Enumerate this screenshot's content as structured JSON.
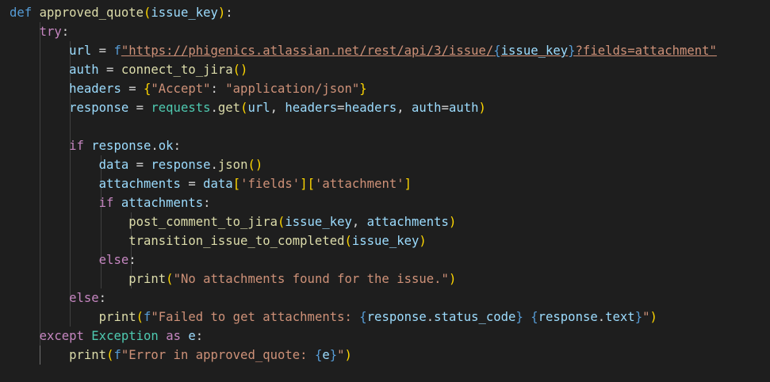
{
  "editor": {
    "language": "python",
    "theme": {
      "background": "#1e1e1e",
      "default": "#d4d4d4",
      "keyword": "#569cd6",
      "control": "#c586c0",
      "function": "#dcdcaa",
      "variable": "#9cdcfe",
      "string": "#ce9178",
      "class": "#4ec9b0",
      "bracket1": "#ffd700",
      "bracket2": "#da70d6",
      "bracket3": "#179fff"
    },
    "lines": [
      [
        [
          "def",
          "keyword"
        ],
        [
          " ",
          "default"
        ],
        [
          "approved_quote",
          "function"
        ],
        [
          "(",
          "bracket1"
        ],
        [
          "issue_key",
          "variable"
        ],
        [
          ")",
          "bracket1"
        ],
        [
          ":",
          "default"
        ]
      ],
      [
        [
          "    ",
          "default"
        ],
        [
          "try",
          "control"
        ],
        [
          ":",
          "default"
        ]
      ],
      [
        [
          "        ",
          "default"
        ],
        [
          "url",
          "variable"
        ],
        [
          " = ",
          "default"
        ],
        [
          "f",
          "keyword"
        ],
        [
          "\"https://phigenics.atlassian.net/rest/api/3/issue/",
          "string-link"
        ],
        [
          "{",
          "keyword-link"
        ],
        [
          "issue_key",
          "variable-link"
        ],
        [
          "}",
          "keyword-link"
        ],
        [
          "?fields=attachment\"",
          "string-link"
        ]
      ],
      [
        [
          "        ",
          "default"
        ],
        [
          "auth",
          "variable"
        ],
        [
          " = ",
          "default"
        ],
        [
          "connect_to_jira",
          "function"
        ],
        [
          "()",
          "bracket1"
        ]
      ],
      [
        [
          "        ",
          "default"
        ],
        [
          "headers",
          "variable"
        ],
        [
          " = ",
          "default"
        ],
        [
          "{",
          "bracket1"
        ],
        [
          "\"Accept\"",
          "string"
        ],
        [
          ": ",
          "default"
        ],
        [
          "\"application/json\"",
          "string"
        ],
        [
          "}",
          "bracket1"
        ]
      ],
      [
        [
          "        ",
          "default"
        ],
        [
          "response",
          "variable"
        ],
        [
          " = ",
          "default"
        ],
        [
          "requests",
          "class"
        ],
        [
          ".",
          "default"
        ],
        [
          "get",
          "function"
        ],
        [
          "(",
          "bracket1"
        ],
        [
          "url",
          "variable"
        ],
        [
          ", ",
          "default"
        ],
        [
          "headers",
          "variable"
        ],
        [
          "=",
          "default"
        ],
        [
          "headers",
          "variable"
        ],
        [
          ", ",
          "default"
        ],
        [
          "auth",
          "variable"
        ],
        [
          "=",
          "default"
        ],
        [
          "auth",
          "variable"
        ],
        [
          ")",
          "bracket1"
        ]
      ],
      [],
      [
        [
          "        ",
          "default"
        ],
        [
          "if",
          "control"
        ],
        [
          " ",
          "default"
        ],
        [
          "response",
          "variable"
        ],
        [
          ".",
          "default"
        ],
        [
          "ok",
          "variable"
        ],
        [
          ":",
          "default"
        ]
      ],
      [
        [
          "            ",
          "default"
        ],
        [
          "data",
          "variable"
        ],
        [
          " = ",
          "default"
        ],
        [
          "response",
          "variable"
        ],
        [
          ".",
          "default"
        ],
        [
          "json",
          "function"
        ],
        [
          "()",
          "bracket1"
        ]
      ],
      [
        [
          "            ",
          "default"
        ],
        [
          "attachments",
          "variable"
        ],
        [
          " = ",
          "default"
        ],
        [
          "data",
          "variable"
        ],
        [
          "[",
          "bracket1"
        ],
        [
          "'fields'",
          "string"
        ],
        [
          "]",
          "bracket1"
        ],
        [
          "[",
          "bracket1"
        ],
        [
          "'attachment'",
          "string"
        ],
        [
          "]",
          "bracket1"
        ]
      ],
      [
        [
          "            ",
          "default"
        ],
        [
          "if",
          "control"
        ],
        [
          " ",
          "default"
        ],
        [
          "attachments",
          "variable"
        ],
        [
          ":",
          "default"
        ]
      ],
      [
        [
          "                ",
          "default"
        ],
        [
          "post_comment_to_jira",
          "function"
        ],
        [
          "(",
          "bracket1"
        ],
        [
          "issue_key",
          "variable"
        ],
        [
          ", ",
          "default"
        ],
        [
          "attachments",
          "variable"
        ],
        [
          ")",
          "bracket1"
        ]
      ],
      [
        [
          "                ",
          "default"
        ],
        [
          "transition_issue_to_completed",
          "function"
        ],
        [
          "(",
          "bracket1"
        ],
        [
          "issue_key",
          "variable"
        ],
        [
          ")",
          "bracket1"
        ]
      ],
      [
        [
          "            ",
          "default"
        ],
        [
          "else",
          "control"
        ],
        [
          ":",
          "default"
        ]
      ],
      [
        [
          "                ",
          "default"
        ],
        [
          "print",
          "function"
        ],
        [
          "(",
          "bracket1"
        ],
        [
          "\"No attachments found for the issue.\"",
          "string"
        ],
        [
          ")",
          "bracket1"
        ]
      ],
      [
        [
          "        ",
          "default"
        ],
        [
          "else",
          "control"
        ],
        [
          ":",
          "default"
        ]
      ],
      [
        [
          "            ",
          "default"
        ],
        [
          "print",
          "function"
        ],
        [
          "(",
          "bracket1"
        ],
        [
          "f",
          "keyword"
        ],
        [
          "\"Failed to get attachments: ",
          "string"
        ],
        [
          "{",
          "keyword"
        ],
        [
          "response",
          "variable"
        ],
        [
          ".",
          "default"
        ],
        [
          "status_code",
          "variable"
        ],
        [
          "}",
          "keyword"
        ],
        [
          " ",
          "string"
        ],
        [
          "{",
          "keyword"
        ],
        [
          "response",
          "variable"
        ],
        [
          ".",
          "default"
        ],
        [
          "text",
          "variable"
        ],
        [
          "}",
          "keyword"
        ],
        [
          "\"",
          "string"
        ],
        [
          ")",
          "bracket1"
        ]
      ],
      [
        [
          "    ",
          "default"
        ],
        [
          "except",
          "control"
        ],
        [
          " ",
          "default"
        ],
        [
          "Exception",
          "class"
        ],
        [
          " ",
          "default"
        ],
        [
          "as",
          "control"
        ],
        [
          " ",
          "default"
        ],
        [
          "e",
          "variable"
        ],
        [
          ":",
          "default"
        ]
      ],
      [
        [
          "        ",
          "default"
        ],
        [
          "print",
          "function"
        ],
        [
          "(",
          "bracket1"
        ],
        [
          "f",
          "keyword"
        ],
        [
          "\"Error in approved_quote: ",
          "string"
        ],
        [
          "{",
          "keyword"
        ],
        [
          "e",
          "variable"
        ],
        [
          "}",
          "keyword"
        ],
        [
          "\"",
          "string"
        ],
        [
          ")",
          "bracket1"
        ]
      ]
    ]
  }
}
